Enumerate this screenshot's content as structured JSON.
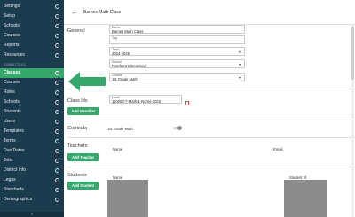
{
  "sidebar": {
    "items_top": [
      {
        "label": "Settings",
        "icon": "gear-icon"
      },
      {
        "label": "Setup",
        "icon": "gear-icon"
      },
      {
        "label": "Schools",
        "icon": "chevron-icon"
      },
      {
        "label": "Courses",
        "icon": "chevron-icon"
      },
      {
        "label": "Reports",
        "icon": "chevron-icon"
      },
      {
        "label": "Resources",
        "icon": "chevron-icon"
      }
    ],
    "section_label": "SUBMITTALS",
    "items_bottom": [
      {
        "label": "Classes",
        "icon": "eye-icon",
        "active": true
      },
      {
        "label": "Courses",
        "icon": "chevron-icon"
      },
      {
        "label": "Roles",
        "icon": "chevron-icon"
      },
      {
        "label": "Schools",
        "icon": "chevron-icon"
      },
      {
        "label": "Students",
        "icon": "chevron-icon"
      },
      {
        "label": "Users",
        "icon": "chevron-icon"
      },
      {
        "label": "Templates",
        "icon": "chevron-icon"
      },
      {
        "label": "Terms",
        "icon": "chevron-icon"
      },
      {
        "label": "Due Dates",
        "icon": "chevron-icon"
      },
      {
        "label": "Jobs",
        "icon": "chevron-icon"
      },
      {
        "label": "District Info",
        "icon": "chevron-icon"
      },
      {
        "label": "Legos",
        "icon": "chevron-icon"
      },
      {
        "label": "Standards",
        "icon": "chevron-icon"
      },
      {
        "label": "Demographics",
        "icon": "chevron-icon"
      }
    ],
    "collapse_glyph": "‹"
  },
  "header": {
    "back_glyph": "←",
    "title": "Barnes Math Class"
  },
  "general": {
    "label": "General",
    "name_label": "Name",
    "name_value": "Barnes Math Class",
    "tag_label": "Tag",
    "tag_value": "",
    "term_label": "Term",
    "term_value": "2024-2025",
    "school_label": "School",
    "school_value": "Forefront Elementary",
    "course_label": "Course",
    "course_value": "1st Grade Math"
  },
  "class_ids": {
    "label": "Class Ids",
    "local_label": "Local",
    "local_value": "110002-7-Math-1-Norris-2023",
    "add_button": "Add Identifier"
  },
  "curricula": {
    "label": "Curricula",
    "item": "1st Grade Math"
  },
  "teachers": {
    "label": "Teachers",
    "col_name": "Name",
    "col_email": "Email",
    "add_button": "Add Teacher"
  },
  "students": {
    "label": "Students",
    "col_name": "Name",
    "col_student_id": "Student Id",
    "add_button": "Add Student"
  },
  "colors": {
    "sidebar_bg": "#1b3b4f",
    "accent_green": "#37a86b",
    "delete_red": "#d9534f"
  }
}
